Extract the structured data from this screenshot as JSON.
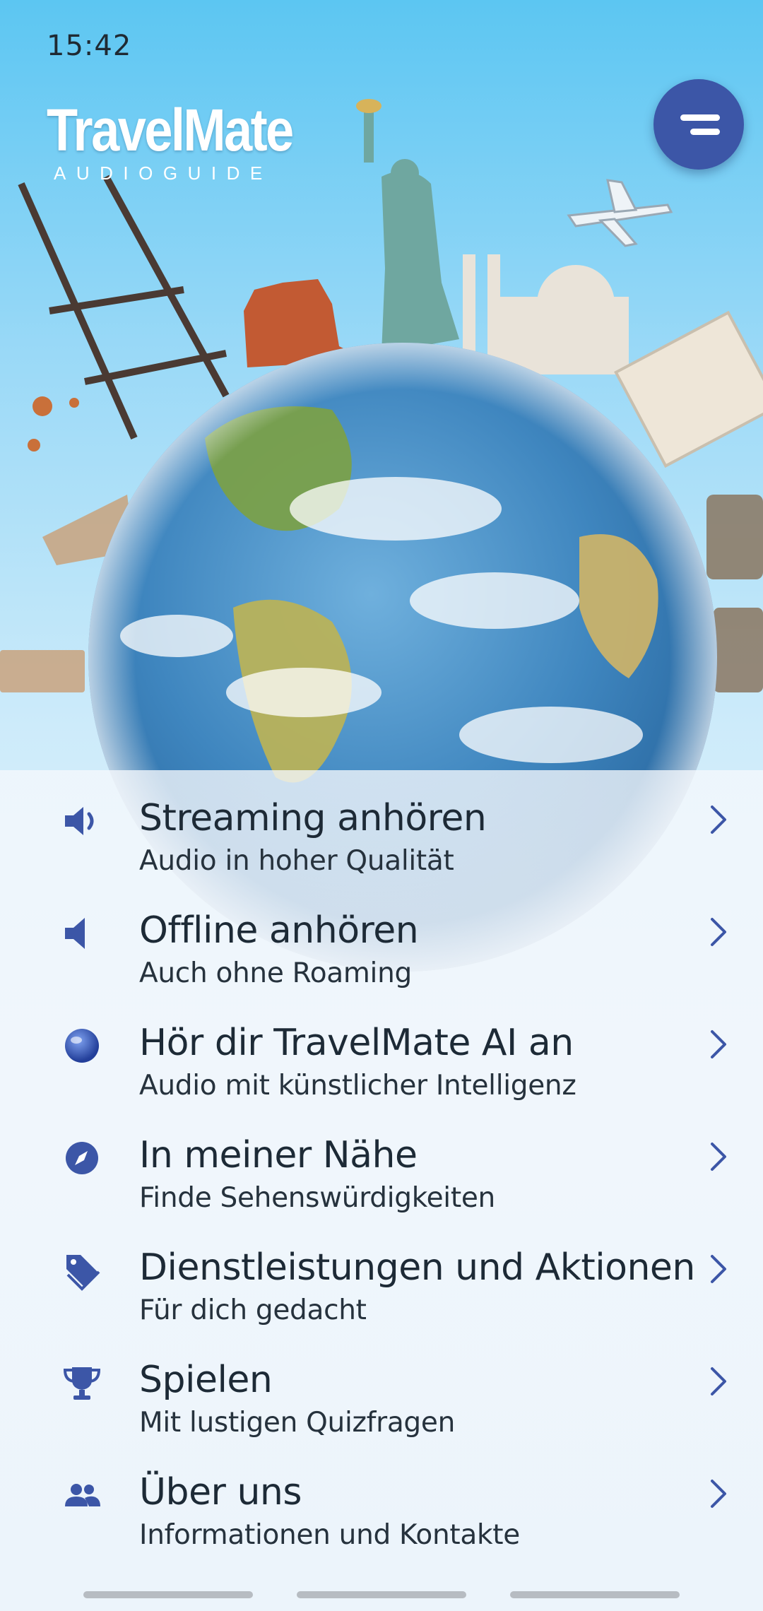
{
  "status_bar": {
    "time": "15:42"
  },
  "app": {
    "logo_title": "TravelMate",
    "logo_subtitle": "AUDIOGUIDE"
  },
  "header": {
    "menu_icon": "menu-lines-icon"
  },
  "colors": {
    "accent": "#3c56a7",
    "icon": "#3c56a7",
    "text": "#1d2a36"
  },
  "menu": {
    "items": [
      {
        "icon": "speaker-loud-icon",
        "title": "Streaming anhören",
        "subtitle": "Audio in hoher Qualität"
      },
      {
        "icon": "speaker-icon",
        "title": "Offline anhören",
        "subtitle": "Auch ohne Roaming"
      },
      {
        "icon": "globe-icon",
        "title": "Hör dir TravelMate AI an",
        "subtitle": "Audio mit künstlicher Intelligenz"
      },
      {
        "icon": "compass-icon",
        "title": "In meiner Nähe",
        "subtitle": "Finde Sehenswürdigkeiten"
      },
      {
        "icon": "tag-icon",
        "title": "Dienstleistungen und Aktionen",
        "subtitle": "Für dich gedacht"
      },
      {
        "icon": "trophy-icon",
        "title": "Spielen",
        "subtitle": "Mit lustigen Quizfragen"
      },
      {
        "icon": "people-icon",
        "title": "Über uns",
        "subtitle": "Informationen und Kontakte"
      }
    ]
  }
}
